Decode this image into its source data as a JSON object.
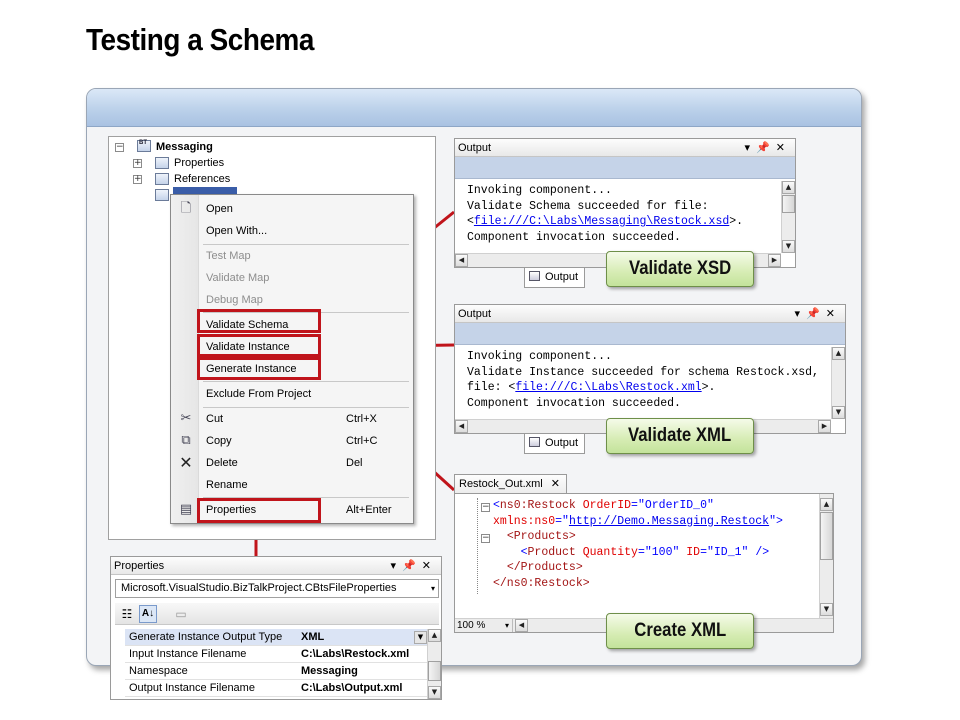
{
  "slide": {
    "title": "Testing a Schema"
  },
  "solution_explorer": {
    "root": "Messaging",
    "root_badge": "BT",
    "items": [
      "Properties",
      "References"
    ]
  },
  "context_menu": {
    "items": [
      {
        "label": "Open",
        "shortcut": "",
        "disabled": false
      },
      {
        "label": "Open With...",
        "shortcut": "",
        "disabled": false
      },
      {
        "label": "Test Map",
        "shortcut": "",
        "disabled": true
      },
      {
        "label": "Validate Map",
        "shortcut": "",
        "disabled": true
      },
      {
        "label": "Debug Map",
        "shortcut": "",
        "disabled": true
      },
      {
        "label": "Validate Schema",
        "shortcut": "",
        "disabled": false
      },
      {
        "label": "Validate Instance",
        "shortcut": "",
        "disabled": false
      },
      {
        "label": "Generate Instance",
        "shortcut": "",
        "disabled": false
      },
      {
        "label": "Exclude From Project",
        "shortcut": "",
        "disabled": false
      },
      {
        "label": "Cut",
        "shortcut": "Ctrl+X",
        "disabled": false
      },
      {
        "label": "Copy",
        "shortcut": "Ctrl+C",
        "disabled": false
      },
      {
        "label": "Delete",
        "shortcut": "Del",
        "disabled": false
      },
      {
        "label": "Rename",
        "shortcut": "",
        "disabled": false
      },
      {
        "label": "Properties",
        "shortcut": "Alt+Enter",
        "disabled": false
      }
    ]
  },
  "output1": {
    "title": "Output",
    "lines": [
      "Invoking component...",
      "Validate Schema succeeded for file:",
      "<",
      "file:///C:\\Labs\\Messaging\\Restock.xsd",
      ">.",
      "Component invocation succeeded."
    ],
    "tab": "Output",
    "callout": "Validate XSD"
  },
  "output2": {
    "title": "Output",
    "lines": [
      "Invoking component...",
      "Validate Instance succeeded for schema Restock.xsd,",
      "file: <",
      "file:///C:\\Labs\\Restock.xml",
      ">.",
      "Component invocation succeeded."
    ],
    "tab": "Output",
    "callout": "Validate XML"
  },
  "xml_editor": {
    "tab": "Restock_Out.xml",
    "zoom": "100 %",
    "lines": {
      "l1_open": "<",
      "l1_tag": "ns0:Restock",
      "l1_attr": " OrderID",
      "l1_eq": "=\"",
      "l1_val": "OrderID_0",
      "l1_end": "\"",
      "l2_attr": "xmlns:ns0",
      "l2_eq": "=\"",
      "l2_val": "http://Demo.Messaging.Restock",
      "l2_end": "\">",
      "l3": "<Products>",
      "l4_open": "<",
      "l4_tag": "Product",
      "l4_attr1": " Quantity",
      "l4_val1": "\"100\"",
      "l4_attr2": " ID",
      "l4_val2": "\"ID_1\"",
      "l4_end": " />",
      "l5": "</Products>",
      "l6": "</ns0:Restock>"
    },
    "callout": "Create XML"
  },
  "properties": {
    "title": "Properties",
    "object": "Microsoft.VisualStudio.BizTalkProject.CBtsFileProperties",
    "rows": [
      {
        "name": "Generate Instance Output Type",
        "value": "XML"
      },
      {
        "name": "Input Instance Filename",
        "value": "C:\\Labs\\Restock.xml"
      },
      {
        "name": "Namespace",
        "value": "Messaging"
      },
      {
        "name": "Output Instance Filename",
        "value": "C:\\Labs\\Output.xml"
      }
    ]
  },
  "colors": {
    "highlight": "#c0141b",
    "callout_fill": "#d6ecb3",
    "selected_row": "#dbe4f5"
  }
}
